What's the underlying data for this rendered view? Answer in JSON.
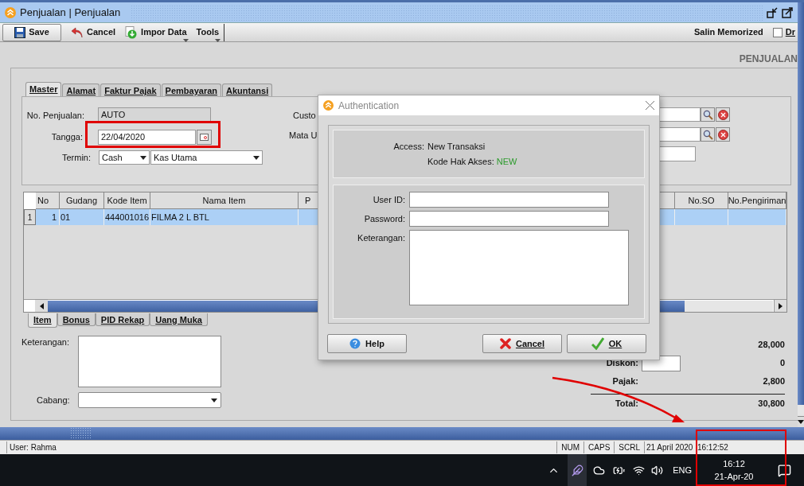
{
  "window": {
    "title": "Penjualan | Penjualan"
  },
  "toolbar": {
    "buttons": [
      {
        "label": "Save",
        "kind": "save"
      },
      {
        "label": "Cancel",
        "kind": "cancel"
      },
      {
        "label": "Impor Data",
        "kind": "import"
      },
      {
        "label": "Tools",
        "kind": "tools"
      }
    ],
    "memorized_label": "Salin Memorized",
    "draft_checkbox": {
      "label": "Dr",
      "checked": false
    }
  },
  "form_title": "PENJUALAN",
  "tabs": [
    {
      "label": "Master",
      "selected": true
    },
    {
      "label": "Alamat",
      "selected": false
    },
    {
      "label": "Faktur Pajak",
      "selected": false
    },
    {
      "label": "Pembayaran",
      "selected": false
    },
    {
      "label": "Akuntansi",
      "selected": false
    }
  ],
  "master": {
    "number": {
      "label": "No. Penjualan:",
      "value": "AUTO"
    },
    "date": {
      "label": "Tangga:",
      "value": "22/04/2020"
    },
    "terms": {
      "label": "Termin:",
      "value": "Cash",
      "account": "Kas Utama"
    },
    "customer_label": "Custo",
    "currency_label": "Mata U"
  },
  "table": {
    "columns": [
      "No",
      "Gudang",
      "Kode Item",
      "Nama Item",
      "P",
      "No.SO",
      "No.Pengiriman"
    ],
    "rows": [
      {
        "header": "1",
        "selected": true,
        "cells": [
          "1",
          "01",
          "444001016",
          "FILMA 2 L BTL",
          "",
          "",
          ""
        ]
      }
    ]
  },
  "bottom_tabs": [
    {
      "label": "Item",
      "selected": true
    },
    {
      "label": "Bonus",
      "selected": false
    },
    {
      "label": "PID Rekap",
      "selected": false
    },
    {
      "label": "Uang Muka",
      "selected": false
    }
  ],
  "notes_label": "Keterangan:",
  "branch_label": "Cabang:",
  "totals": [
    {
      "value": "28,000",
      "kind": "plain"
    },
    {
      "label": "Diskon:",
      "value": "0",
      "kind": "input"
    },
    {
      "label": "Pajak:",
      "value": "2,800",
      "kind": "plain"
    },
    {
      "label": "Total:",
      "value": "30,800",
      "kind": "total"
    }
  ],
  "status_bar": {
    "user": "User: Rahma",
    "indicators": [
      "NUM",
      "CAPS",
      "SCRL"
    ],
    "datetime": "21 April 2020  16:12:52"
  },
  "taskbar": {
    "language": "ENG",
    "time": "16:12",
    "date": "21-Apr-20"
  },
  "dialog": {
    "title": "Authentication",
    "access_label": "Access:",
    "access_value": "New Transaksi",
    "code_label": "Kode Hak Akses:",
    "code_value": "NEW",
    "fields": [
      {
        "label": "User ID:",
        "kind": "text"
      },
      {
        "label": "Password:",
        "kind": "password"
      },
      {
        "label": "Keterangan:",
        "kind": "textarea"
      }
    ],
    "buttons": [
      {
        "label": "Help",
        "kind": "help"
      },
      {
        "label": "Cancel",
        "kind": "cancel"
      },
      {
        "label": "OK",
        "kind": "ok"
      }
    ]
  }
}
